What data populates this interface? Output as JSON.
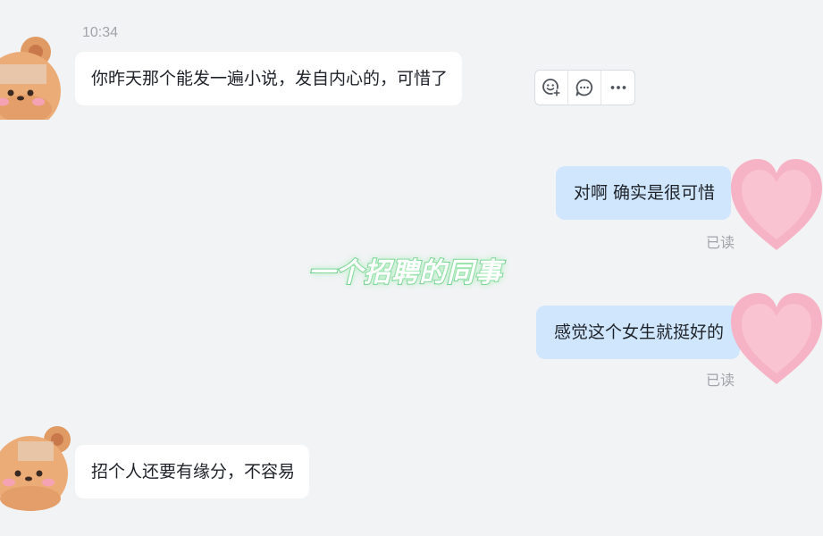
{
  "chat": {
    "timestamp": "10:34",
    "messages": [
      {
        "side": "left",
        "text": "你昨天那个能发一遍小说，发自内心的，可惜了"
      },
      {
        "side": "right",
        "text": "对啊 确实是很可惜",
        "status": "已读"
      },
      {
        "side": "right",
        "text": "感觉这个女生就挺好的",
        "status": "已读"
      },
      {
        "side": "left",
        "text": "招个人还要有缘分，不容易"
      }
    ],
    "actions": [
      {
        "icon": "emoji-add-icon"
      },
      {
        "icon": "reply-bubble-icon"
      },
      {
        "icon": "more-options-icon"
      }
    ]
  },
  "overlay": {
    "caption": "一个招聘的同事"
  },
  "colors": {
    "background": "#f2f3f5",
    "left_bubble": "#ffffff",
    "right_bubble": "#cfe6fd",
    "caption_outline": "#4fc072"
  }
}
